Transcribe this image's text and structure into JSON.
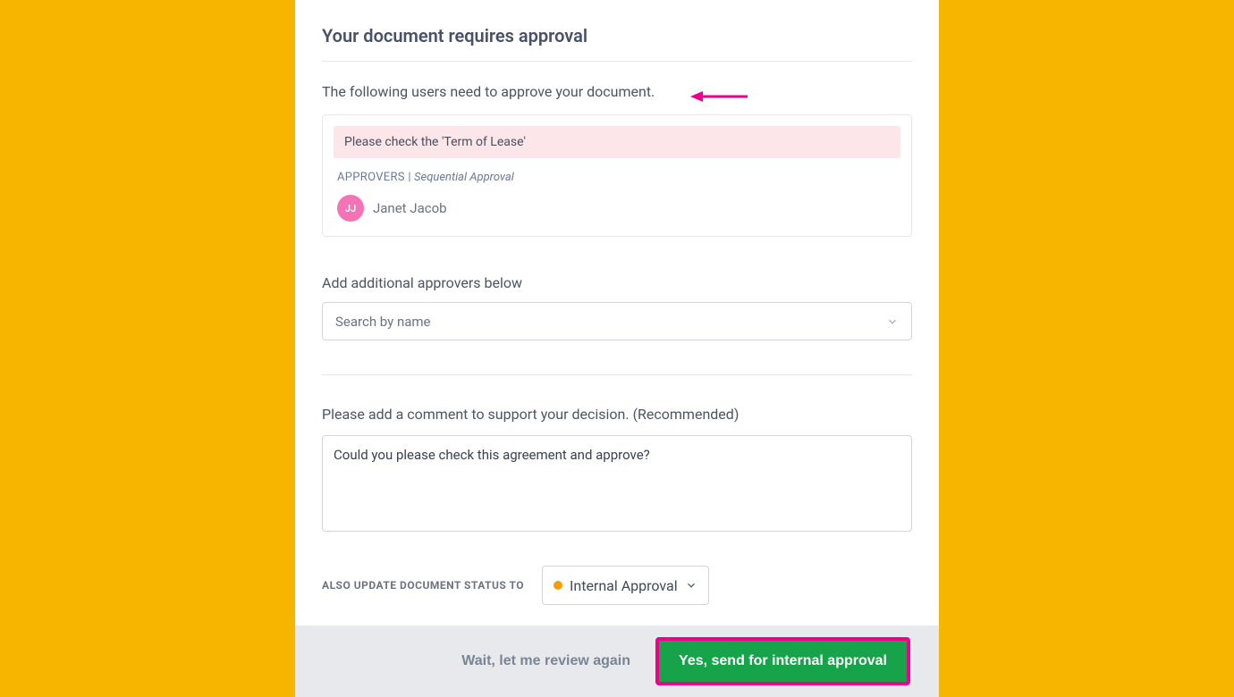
{
  "header": {
    "title": "Your document requires approval",
    "subtitle": "The following users need to approve your document."
  },
  "approvers_card": {
    "notice": "Please check the 'Term of Lease'",
    "label": "APPROVERS |",
    "mode": "Sequential Approval",
    "list": [
      {
        "initials": "JJ",
        "name": "Janet Jacob"
      }
    ]
  },
  "add_approvers": {
    "label": "Add additional approvers below",
    "placeholder": "Search by name"
  },
  "comment": {
    "label": "Please add a comment to support your decision. (Recommended)",
    "value": "Could you please check this agreement and approve?"
  },
  "status": {
    "label": "ALSO UPDATE DOCUMENT STATUS TO",
    "selected": "Internal Approval"
  },
  "footer": {
    "secondary": "Wait, let me review again",
    "primary": "Yes, send for internal approval"
  }
}
